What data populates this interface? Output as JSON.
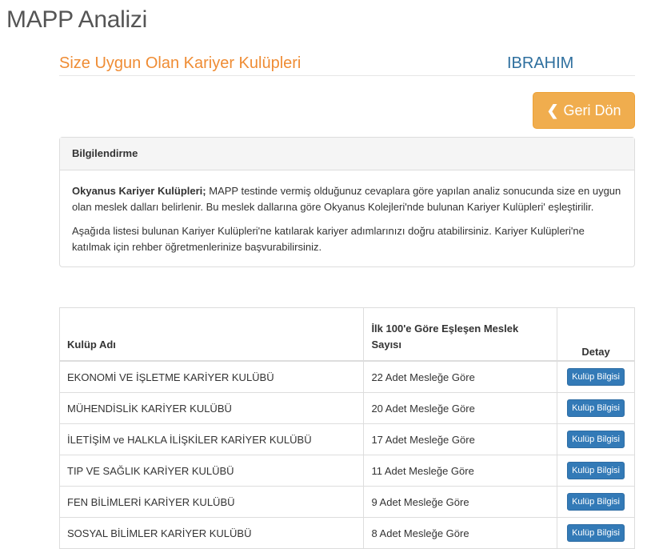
{
  "page": {
    "title": "MAPP Analizi"
  },
  "header": {
    "section_title": "Size Uygun Olan Kariyer Kulüpleri",
    "user_name": "IBRAHIM",
    "back_button_label": "Geri Dön"
  },
  "info_panel": {
    "heading": "Bilgilendirme",
    "p1_bold": "Okyanus Kariyer Kulüpleri;",
    "p1_text": " MAPP testinde vermiş olduğunuz cevaplara göre yapılan analiz sonucunda size en uygun olan meslek dalları belirlenir. Bu meslek dallarına göre Okyanus Kolejleri'nde bulunan Kariyer Kulüpleri' eşleştirilir.",
    "p2_text": "Aşağıda listesi bulunan Kariyer Kulüpleri'ne katılarak kariyer adımlarınızı doğru atabilirsiniz. Kariyer Kulüpleri'ne katılmak için rehber öğretmenlerinize başvurabilirsiniz."
  },
  "table": {
    "headers": {
      "club": "Kulüp Adı",
      "match": "İlk 100'e Göre Eşleşen Meslek Sayısı",
      "detail": "Detay"
    },
    "rows": [
      {
        "club": "EKONOMİ VE İŞLETME KARİYER KULÜBÜ",
        "match": "22 Adet Mesleğe Göre",
        "button": "Kulüp Bilgisi"
      },
      {
        "club": "MÜHENDİSLİK KARİYER KULÜBÜ",
        "match": "20 Adet Mesleğe Göre",
        "button": "Kulüp Bilgisi"
      },
      {
        "club": "İLETİŞİM ve HALKLA İLİŞKİLER KARİYER KULÜBÜ",
        "match": "17 Adet Mesleğe Göre",
        "button": "Kulüp Bilgisi"
      },
      {
        "club": "TIP VE SAĞLIK KARİYER KULÜBÜ",
        "match": "11 Adet Mesleğe Göre",
        "button": "Kulüp Bilgisi"
      },
      {
        "club": "FEN BİLİMLERİ KARİYER KULÜBÜ",
        "match": "9 Adet Mesleğe Göre",
        "button": "Kulüp Bilgisi"
      },
      {
        "club": "SOSYAL BİLİMLER KARİYER KULÜBÜ",
        "match": "8 Adet Mesleğe Göre",
        "button": "Kulüp Bilgisi"
      }
    ]
  },
  "colors": {
    "section_title": "#ef8c34",
    "user_name": "#2e6f9e",
    "warning_button": "#f0ad4e",
    "primary_button": "#337ab7"
  },
  "icons": {
    "back": "chevron-left-icon"
  }
}
